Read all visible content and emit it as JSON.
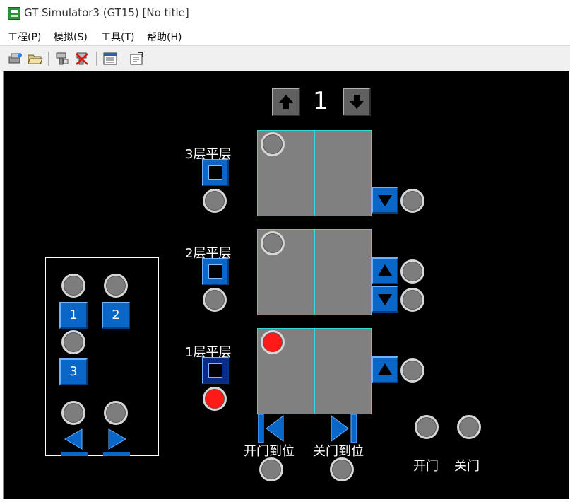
{
  "window": {
    "title": "GT Simulator3 (GT15)  [No title]"
  },
  "menu": [
    {
      "label": "工程(P)"
    },
    {
      "label": "模拟(S)"
    },
    {
      "label": "工具(T)"
    },
    {
      "label": "帮助(H)"
    }
  ],
  "toolbar": {
    "icons": [
      "start-sim-icon",
      "open-icon",
      "device-monitor-icon",
      "stop-icon",
      "list-icon",
      "properties-icon"
    ]
  },
  "screen": {
    "floor_indicator": "1",
    "floors": [
      {
        "label": "3层平层"
      },
      {
        "label": "2层平层"
      },
      {
        "label": "1层平层"
      }
    ],
    "call_panel": {
      "buttons": [
        "1",
        "2",
        "3"
      ]
    },
    "door_labels": {
      "open_limit": "开门到位",
      "close_limit": "关门到位",
      "open": "开门",
      "close": "关门"
    }
  },
  "colors": {
    "screen_bg": "#000000",
    "car_fill": "#808080",
    "car_border": "#34d8d8",
    "button_blue": "#0a67c8",
    "lamp_on": "#ff1a1a",
    "lamp_off": "#7d7d7d"
  }
}
